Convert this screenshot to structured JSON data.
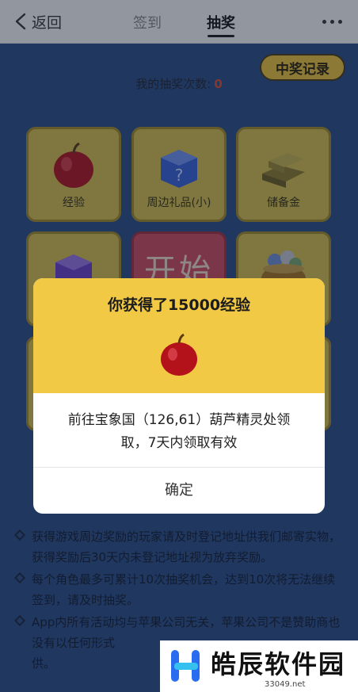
{
  "nav": {
    "back_label": "返回",
    "tabs": [
      {
        "label": "签到",
        "active": false
      },
      {
        "label": "抽奖",
        "active": true
      }
    ],
    "more_icon": "more-horizontal-icon"
  },
  "lottery": {
    "record_button": "中奖记录",
    "count_label": "我的抽奖次数:",
    "count_value": "0",
    "cells": [
      {
        "label": "经验",
        "icon": "apple-icon"
      },
      {
        "label": "周边礼品(小)",
        "icon": "mystery-box-blue-icon"
      },
      {
        "label": "储备金",
        "icon": "gold-bars-icon"
      },
      {
        "label": "",
        "icon": "mystery-box-purple-icon"
      },
      {
        "label": "",
        "icon": "treasure-pot-icon"
      }
    ],
    "start_label": "开始"
  },
  "modal": {
    "title": "你获得了15000经验",
    "prize_icon": "apple-icon",
    "message_line1": "前往宝象国（126,61）葫芦精灵处领",
    "message_line2": "取，7天内领取有效",
    "confirm_label": "确定"
  },
  "rules": [
    "获得游戏周边奖励的玩家请及时登记地址供我们邮寄实物，获得奖励后30天内未登记地址视为放弃奖励。",
    "每个角色最多可累计10次抽奖机会，达到10次将无法继续签到，请及时抽奖。",
    "App内所有活动均与苹果公司无关，苹果公司不是赞助商也没有以任何形式"
  ],
  "rules_tail": "供。",
  "watermark": {
    "brand": "皓辰软件园",
    "url": "33049.net"
  },
  "colors": {
    "background": "#2b4c86",
    "accent_yellow": "#f2c945",
    "cell_yellow": "#d8c04a",
    "start_red": "#d2495b",
    "count_red": "#e34b2a"
  }
}
